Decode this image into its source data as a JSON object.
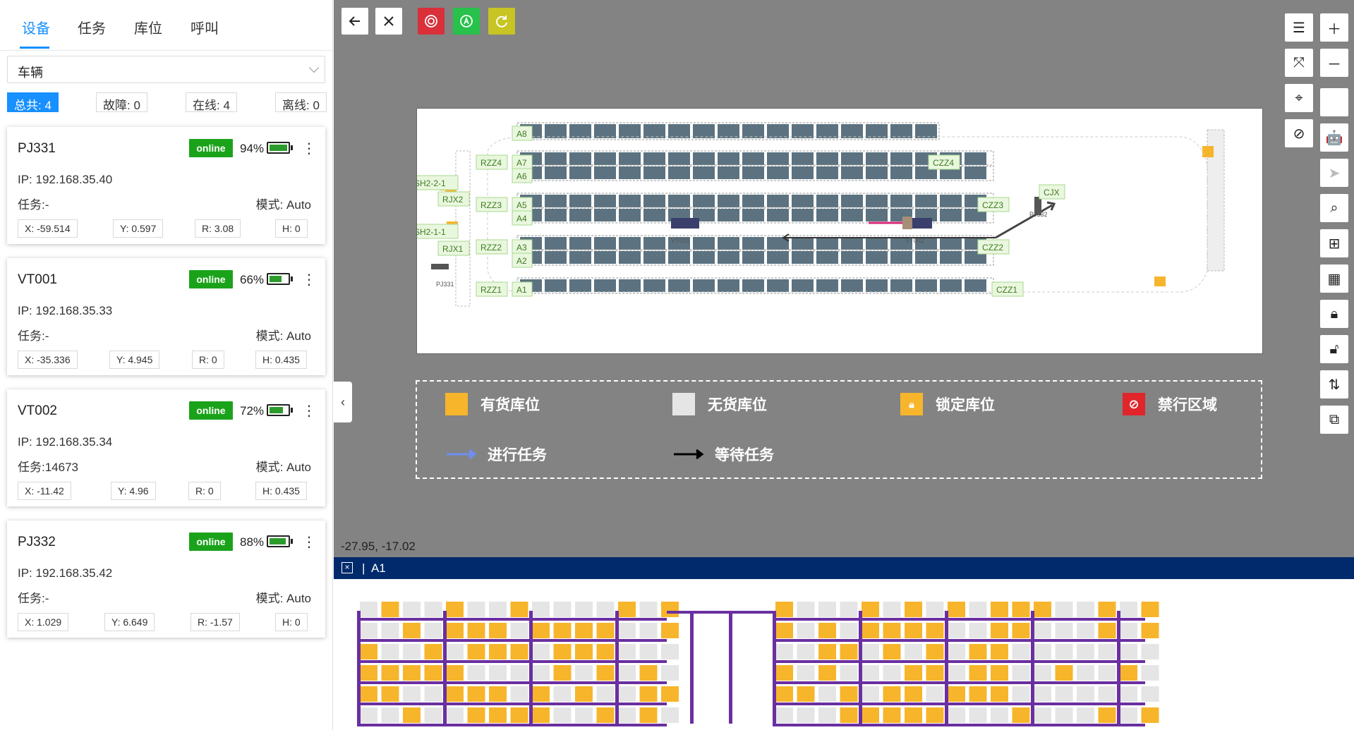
{
  "tabs": [
    {
      "label": "设备",
      "active": true
    },
    {
      "label": "任务",
      "active": false
    },
    {
      "label": "库位",
      "active": false
    },
    {
      "label": "呼叫",
      "active": false
    }
  ],
  "filter": {
    "selected": "车辆"
  },
  "stats": [
    {
      "label": "总共: 4",
      "active": true
    },
    {
      "label": "故障: 0",
      "active": false
    },
    {
      "label": "在线: 4",
      "active": false
    },
    {
      "label": "离线: 0",
      "active": false
    }
  ],
  "devices": [
    {
      "name": "PJ331",
      "status": "online",
      "battery": 94,
      "battery_text": "94%",
      "charging": true,
      "ip": "IP: 192.168.35.40",
      "task": "任务:-",
      "mode": "模式: Auto",
      "x": "X: -59.514",
      "y": "Y: 0.597",
      "r": "R: 3.08",
      "h": "H: 0"
    },
    {
      "name": "VT001",
      "status": "online",
      "battery": 66,
      "battery_text": "66%",
      "charging": false,
      "ip": "IP: 192.168.35.33",
      "task": "任务:-",
      "mode": "模式: Auto",
      "x": "X: -35.336",
      "y": "Y: 4.945",
      "r": "R: 0",
      "h": "H: 0.435"
    },
    {
      "name": "VT002",
      "status": "online",
      "battery": 72,
      "battery_text": "72%",
      "charging": false,
      "ip": "IP: 192.168.35.34",
      "task": "任务:14673",
      "mode": "模式: Auto",
      "x": "X: -11.42",
      "y": "Y: 4.96",
      "r": "R: 0",
      "h": "H: 0.435"
    },
    {
      "name": "PJ332",
      "status": "online",
      "battery": 88,
      "battery_text": "88%",
      "charging": false,
      "ip": "IP: 192.168.35.42",
      "task": "任务:-",
      "mode": "模式: Auto",
      "x": "X: 1.029",
      "y": "Y: 6.649",
      "r": "R: -1.57",
      "h": "H: 0"
    }
  ],
  "map": {
    "zone_labels": [
      "A8",
      "A7",
      "A6",
      "A5",
      "A4",
      "A3",
      "A2",
      "A1",
      "RZZ4",
      "RZZ3",
      "RZZ2",
      "RZZ1",
      "RJX2",
      "RJX1",
      "SH2-2-1",
      "SH2-1-1",
      "CZZ4",
      "CZZ3",
      "CZZ2",
      "CZZ1",
      "CJX"
    ],
    "vehicle_labels": [
      "VT001",
      "VT002",
      "PJ331",
      "PJ332"
    ],
    "legend": {
      "occupied": "有货库位",
      "empty": "无货库位",
      "locked": "锁定库位",
      "forbidden": "禁行区域",
      "running_task": "进行任务",
      "waiting_task": "等待任务"
    },
    "cursor_coord": "-27.95, -17.02",
    "colors": {
      "occupied": "#f7b52c",
      "empty": "#e5e5e5",
      "shelf": "#5c7280",
      "forbidden": "#e0252b",
      "running": "#6e8ef0",
      "frame": "#6a2fa0"
    }
  },
  "bottom_panel": {
    "title": "A1",
    "divider": "|"
  }
}
